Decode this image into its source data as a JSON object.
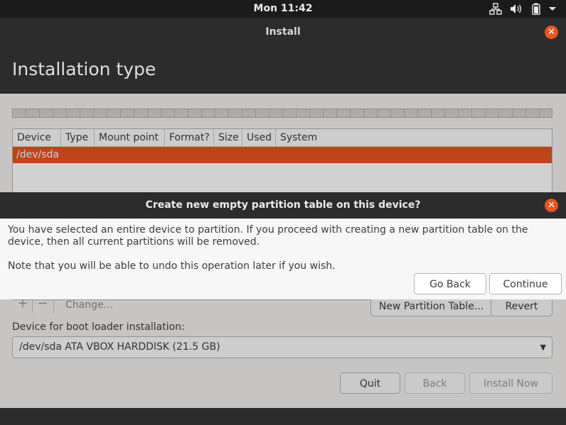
{
  "topbar": {
    "clock": "Mon 11:42",
    "icons": [
      "network-icon",
      "volume-icon",
      "battery-icon",
      "system-menu-arrow-icon"
    ]
  },
  "window": {
    "title": "Install",
    "page_title": "Installation type"
  },
  "partition_table": {
    "columns": [
      "Device",
      "Type",
      "Mount point",
      "Format?",
      "Size",
      "Used",
      "System"
    ],
    "rows": [
      {
        "device": "/dev/sda"
      }
    ]
  },
  "toolbar": {
    "add": "+",
    "remove": "−",
    "change": "Change...",
    "new_partition_table": "New Partition Table...",
    "revert": "Revert"
  },
  "bootloader": {
    "label": "Device for boot loader installation:",
    "selected": "/dev/sda ATA VBOX HARDDISK (21.5 GB)"
  },
  "nav": {
    "quit": "Quit",
    "back": "Back",
    "install_now": "Install Now"
  },
  "dialog": {
    "title": "Create new empty partition table on this device?",
    "message": "You have selected an entire device to partition. If you proceed with creating a new partition table on the device, then all current partitions will be removed.",
    "note": "Note that you will be able to undo this operation later if you wish.",
    "go_back": "Go Back",
    "continue": "Continue"
  },
  "colors": {
    "accent": "#e95420",
    "dark_chrome": "#2c2c2c",
    "topbar": "#1b1b1b",
    "content_bg": "#f2f1f0"
  }
}
